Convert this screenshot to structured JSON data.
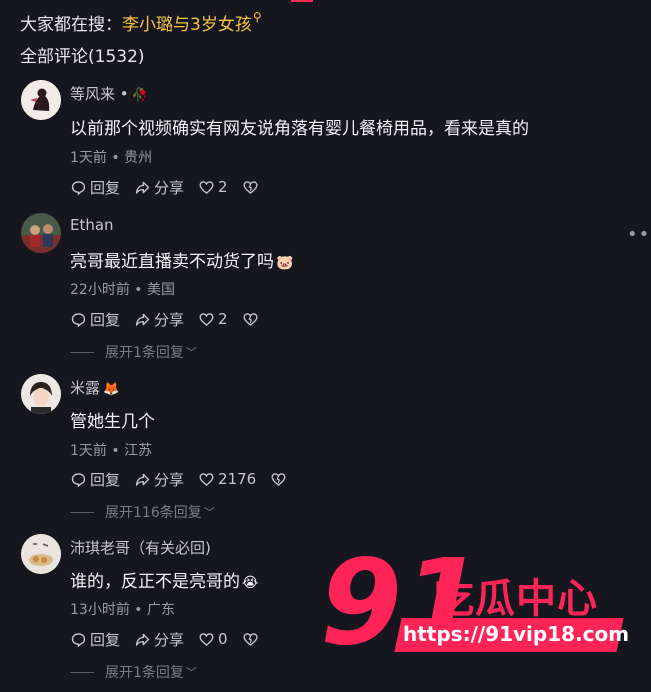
{
  "header": {
    "search_prefix": "大家都在搜：",
    "search_keyword": "李小璐与3岁女孩",
    "search_icon": "search-icon",
    "comment_count": "全部评论(1532)"
  },
  "comments": [
    {
      "username": "等风来 •",
      "badge": "🥀",
      "text": "以前那个视频确实有网友说角落有婴儿餐椅用品，看来是真的",
      "emoji": "",
      "meta": "1天前 • 贵州",
      "reply_label": "回复",
      "share_label": "分享",
      "likes": "2",
      "expand": ""
    },
    {
      "username": "Ethan",
      "badge": "",
      "text": "亮哥最近直播卖不动货了吗",
      "emoji": "🐷",
      "meta": "22小时前 • 美国",
      "reply_label": "回复",
      "share_label": "分享",
      "likes": "2",
      "expand": "展开1条回复"
    },
    {
      "username": "米露",
      "badge": "🦊",
      "text": "管她生几个",
      "emoji": "",
      "meta": "1天前 • 江苏",
      "reply_label": "回复",
      "share_label": "分享",
      "likes": "2176",
      "expand": "展开116条回复"
    },
    {
      "username": "沛琪老哥（有关必回)",
      "badge": "",
      "text": "谁的，反正不是亮哥的",
      "emoji": "😭",
      "meta": "13小时前 • 广东",
      "reply_label": "回复",
      "share_label": "分享",
      "likes": "0",
      "expand": "展开1条回复"
    }
  ],
  "watermark": {
    "number": "91",
    "chinese": "吃瓜中心",
    "url": "https://91vip18.com"
  },
  "colors": {
    "background": "#16161e",
    "keyword": "#f5c542",
    "brand": "#fe2458"
  }
}
